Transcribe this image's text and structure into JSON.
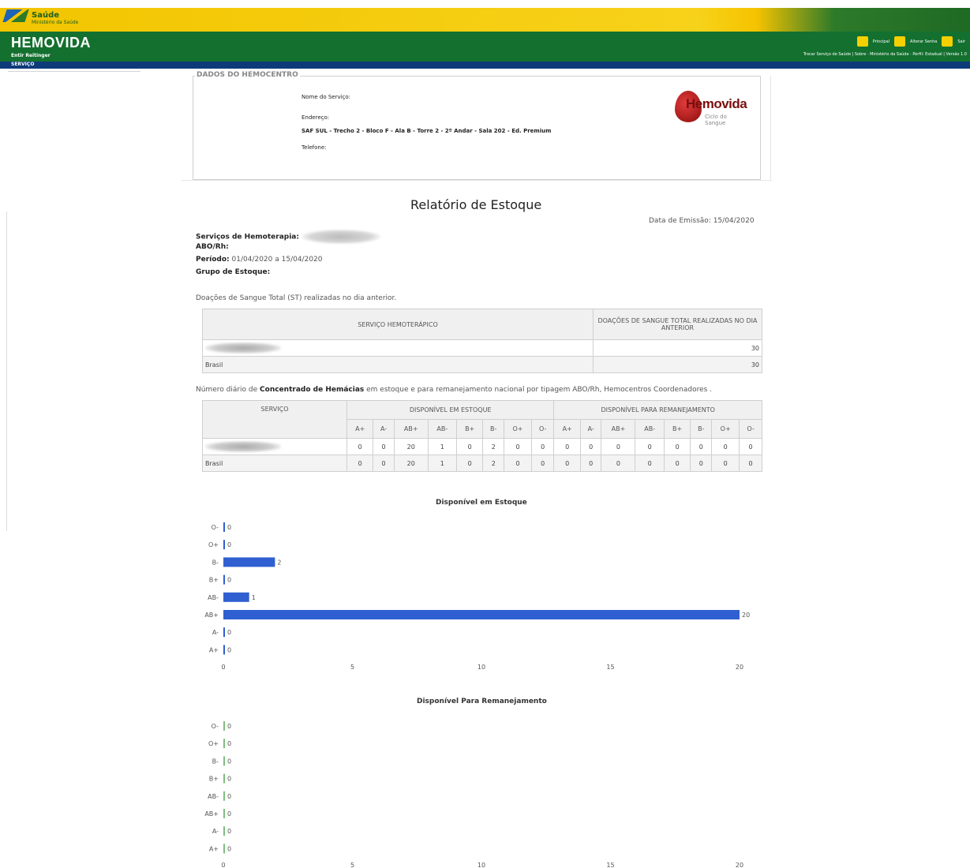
{
  "header": {
    "saude_title": "Saúde",
    "saude_subtitle": "Ministério da Saúde",
    "app_title": "HEMOVIDA",
    "user_label": "Entir Reitinger",
    "top_links": [
      "Principal",
      "Alterar Senha",
      "Sair"
    ],
    "bottom_links": "Trocar Serviço de Saúde | Sobre · Ministério da Saúde · Perfil: Estadual | Versão 1.0",
    "menu": "SERVIÇO"
  },
  "hemocentro": {
    "legend": "DADOS DO HEMOCENTRO",
    "name_label": "Nome do Serviço:",
    "address_label": "Endereço:",
    "address_value": "SAF SUL - Trecho 2 - Bloco F - Ala B - Torre 2 - 2º Andar - Sala 202 - Ed. Premium",
    "phone_label": "Telefone:",
    "logo_name": "Hemovida",
    "logo_tag": "Ciclo do Sangue"
  },
  "report": {
    "title": "Relatório de Estoque",
    "emission": "Data de Emissão: 15/04/2020",
    "service_label": "Serviços de Hemoterapia:",
    "abo_label": "ABO/Rh:",
    "period_label": "Período:",
    "period_value": "01/04/2020 a 15/04/2020",
    "group_label": "Grupo de Estoque:"
  },
  "table1": {
    "desc": "Doações de Sangue Total (ST) realizadas no dia anterior.",
    "headers": [
      "SERVIÇO HEMOTERÁPICO",
      "DOAÇÕES DE SANGUE TOTAL REALIZADAS NO DIA ANTERIOR"
    ],
    "rows": [
      {
        "name": "",
        "value": "30"
      },
      {
        "name": "Brasil",
        "value": "30"
      }
    ]
  },
  "table2": {
    "desc_before": "Número diário de ",
    "desc_bold": "Concentrado de Hemácias",
    "desc_after": " em estoque e para remanejamento nacional por tipagem ABO/Rh, Hemocentros Coordenadores .",
    "service_header": "SERVIÇO",
    "group1": "DISPONÍVEL EM ESTOQUE",
    "group2": "DISPONÍVEL PARA REMANEJAMENTO",
    "types": [
      "A+",
      "A-",
      "AB+",
      "AB-",
      "B+",
      "B-",
      "O+",
      "O-"
    ],
    "rows": [
      {
        "name": "",
        "values": [
          "0",
          "0",
          "20",
          "1",
          "0",
          "2",
          "0",
          "0",
          "0",
          "0",
          "0",
          "0",
          "0",
          "0",
          "0",
          "0"
        ]
      },
      {
        "name": "Brasil",
        "values": [
          "0",
          "0",
          "20",
          "1",
          "0",
          "2",
          "0",
          "0",
          "0",
          "0",
          "0",
          "0",
          "0",
          "0",
          "0",
          "0"
        ]
      }
    ]
  },
  "chart_data": [
    {
      "type": "bar",
      "orientation": "horizontal",
      "title": "Disponível em Estoque",
      "categories": [
        "O-",
        "O+",
        "B-",
        "B+",
        "AB-",
        "AB+",
        "A-",
        "A+"
      ],
      "values": [
        0,
        0,
        2,
        0,
        1,
        20,
        0,
        0
      ],
      "xlim": [
        0,
        20
      ],
      "xticks": [
        0,
        5,
        10,
        15,
        20
      ],
      "color": "#2f5fd0",
      "grid": false
    },
    {
      "type": "bar",
      "orientation": "horizontal",
      "title": "Disponível Para Remanejamento",
      "categories": [
        "O-",
        "O+",
        "B-",
        "B+",
        "AB-",
        "AB+",
        "A-",
        "A+"
      ],
      "values": [
        0,
        0,
        0,
        0,
        0,
        0,
        0,
        0
      ],
      "xlim": [
        0,
        20
      ],
      "xticks": [
        0,
        5,
        10,
        15,
        20
      ],
      "color": "#7fbf7f",
      "grid": false
    }
  ]
}
